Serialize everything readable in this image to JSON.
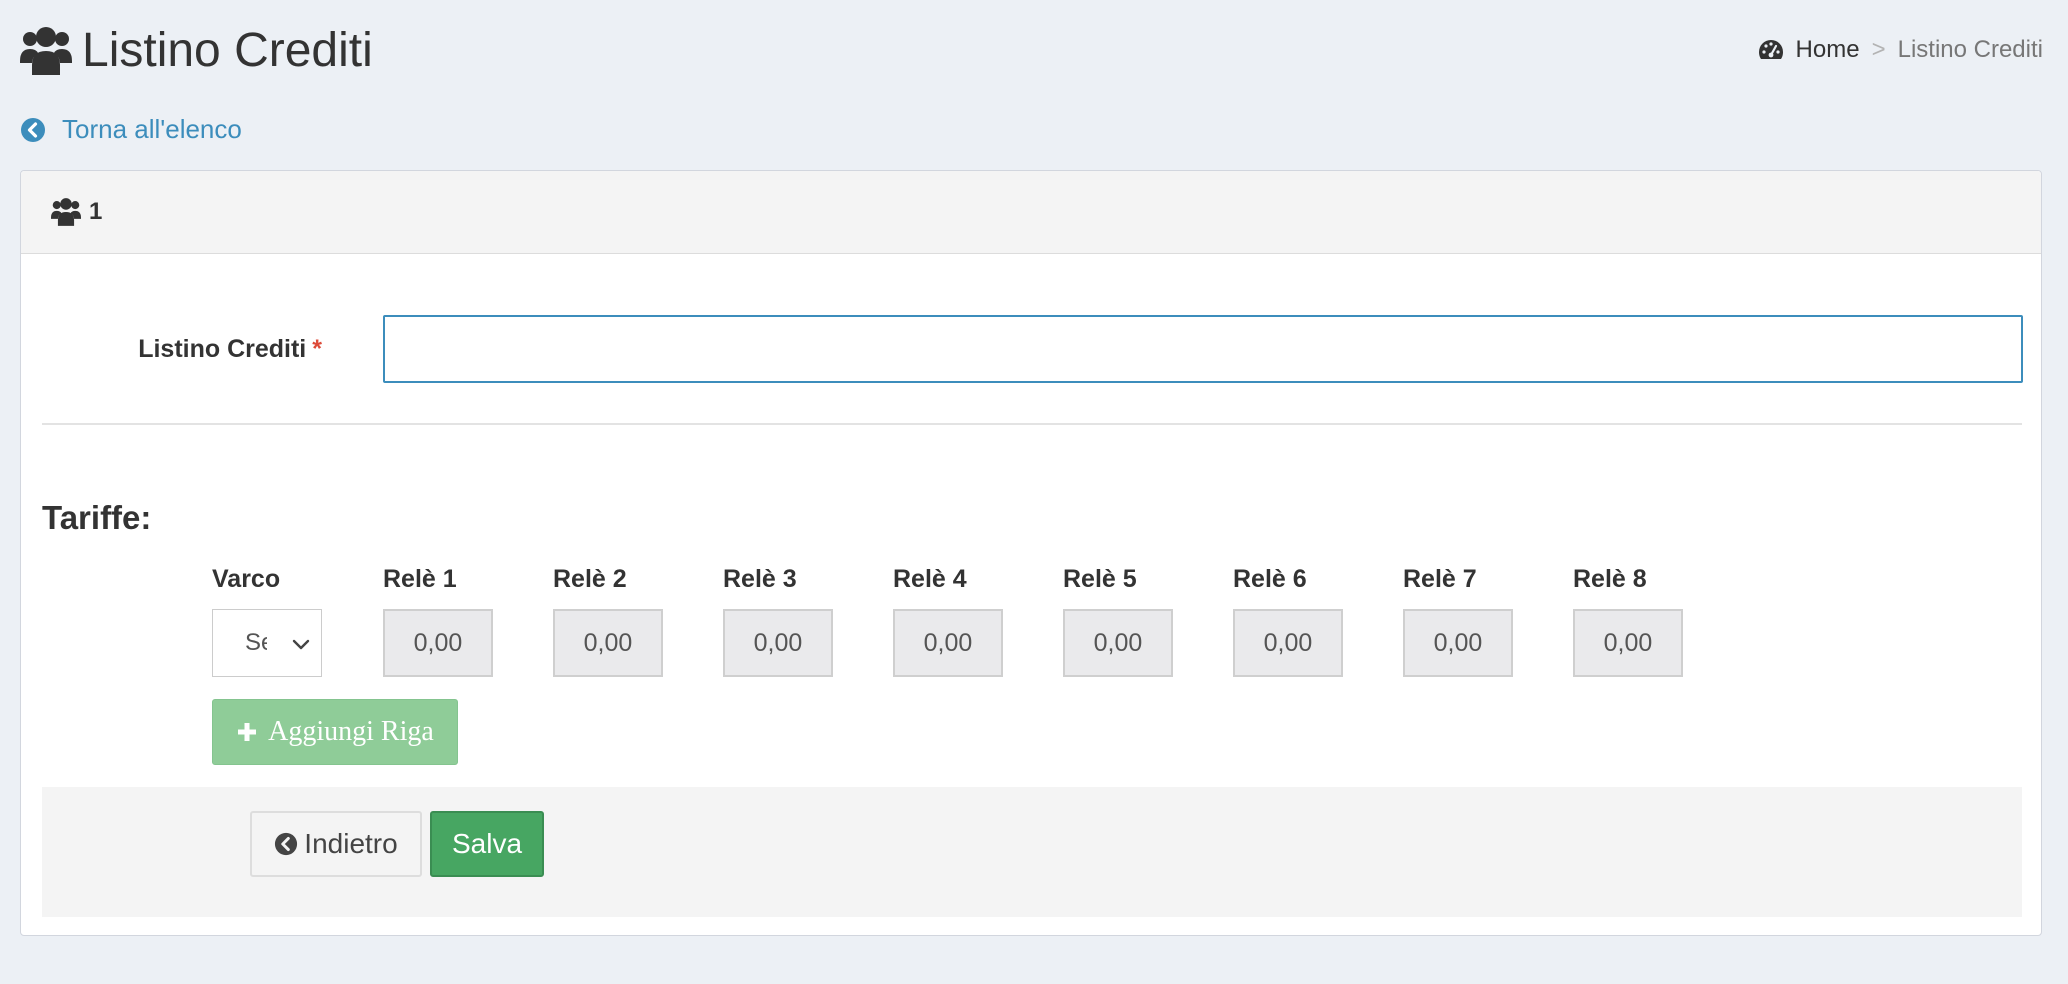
{
  "header": {
    "title": "Listino Crediti",
    "icon": "users-icon"
  },
  "breadcrumb": {
    "icon": "dashboard-icon",
    "home": "Home",
    "separator": ">",
    "current": "Listino Crediti"
  },
  "back_link": {
    "icon": "chevron-circle-left-icon",
    "label": "Torna all'elenco"
  },
  "box": {
    "icon": "users-icon",
    "title": "1"
  },
  "form": {
    "label": "Listino Crediti",
    "required_mark": "*",
    "value": ""
  },
  "tariffe": {
    "title": "Tariffe:",
    "columns": [
      "Varco",
      "Relè 1",
      "Relè 2",
      "Relè 3",
      "Relè 4",
      "Relè 5",
      "Relè 6",
      "Relè 7",
      "Relè 8"
    ],
    "row": {
      "varco_selected": "Se",
      "values": [
        "0,00",
        "0,00",
        "0,00",
        "0,00",
        "0,00",
        "0,00",
        "0,00",
        "0,00"
      ]
    },
    "add_row_label": "Aggiungi Riga"
  },
  "footer": {
    "back_label": "Indietro",
    "save_label": "Salva"
  },
  "colors": {
    "background": "#ecf0f5",
    "link": "#3c8dbc",
    "required": "#dd4b39",
    "save_button": "#47a662",
    "add_row_button": "#8fcc98"
  }
}
